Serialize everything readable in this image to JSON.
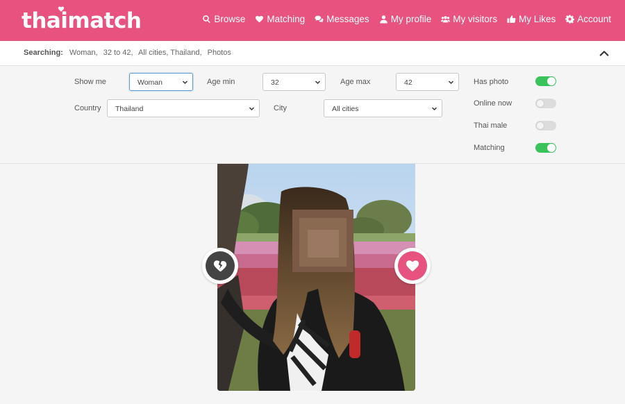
{
  "header": {
    "logo": "thaimatch",
    "nav": [
      {
        "label": "Browse",
        "icon": "search-icon"
      },
      {
        "label": "Matching",
        "icon": "heart-icon"
      },
      {
        "label": "Messages",
        "icon": "chat-icon"
      },
      {
        "label": "My profile",
        "icon": "user-icon"
      },
      {
        "label": "My visitors",
        "icon": "users-icon"
      },
      {
        "label": "My Likes",
        "icon": "thumbs-up-icon"
      },
      {
        "label": "Account",
        "icon": "gear-icon"
      }
    ]
  },
  "search_summary": {
    "label": "Searching:",
    "terms": [
      "Woman,",
      "32 to 42,",
      "All cities, Thailand,",
      "Photos"
    ]
  },
  "filters": {
    "show_me": {
      "label": "Show me",
      "value": "Woman"
    },
    "age_min": {
      "label": "Age min",
      "value": "32"
    },
    "age_max": {
      "label": "Age max",
      "value": "42"
    },
    "country": {
      "label": "Country",
      "value": "Thailand"
    },
    "city": {
      "label": "City",
      "value": "All cities"
    },
    "toggles": [
      {
        "label": "Has photo",
        "on": true
      },
      {
        "label": "Online now",
        "on": false
      },
      {
        "label": "Thai male",
        "on": false
      },
      {
        "label": "Matching",
        "on": true
      }
    ]
  },
  "colors": {
    "brand": "#e8527f",
    "toggle_on": "#3cc25c",
    "toggle_off": "#dcdcdc",
    "dislike": "#444444"
  },
  "card": {
    "dislike_icon": "broken-heart-icon",
    "like_icon": "heart-icon"
  }
}
